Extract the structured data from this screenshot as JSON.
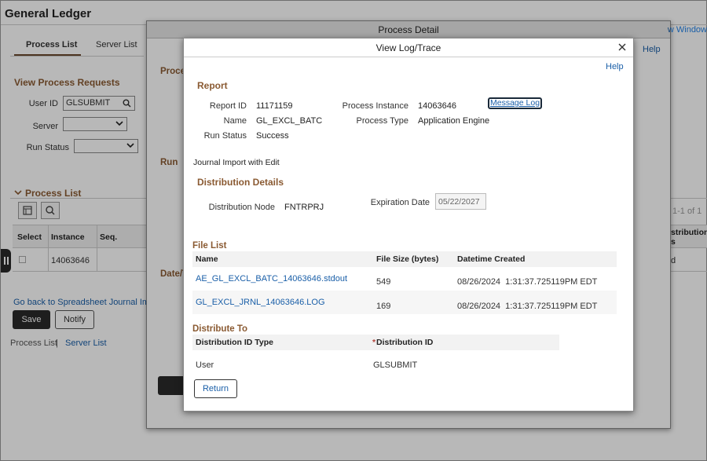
{
  "app": {
    "title": "General Ledger"
  },
  "tabs": [
    {
      "label": "Process List",
      "active": true
    },
    {
      "label": "Server List",
      "active": false
    }
  ],
  "view_requests": {
    "title": "View Process Requests",
    "user_id_label": "User ID",
    "user_id_value": "GLSUBMIT",
    "server_label": "Server",
    "server_value": "",
    "run_status_label": "Run Status",
    "run_status_value": ""
  },
  "process_list": {
    "title": "Process List",
    "pager": "1-1 of 1",
    "columns": [
      "Select",
      "Instance",
      "Seq."
    ],
    "right_col_header": "stribution\ns",
    "rows": [
      {
        "instance": "14063646",
        "right_cell": "d"
      }
    ]
  },
  "left_links": {
    "go_back": "Go back to Spreadsheet Journal Import",
    "save": "Save",
    "notify": "Notify",
    "process_list": "Process List",
    "separator": "|",
    "server_list": "Server List"
  },
  "process_detail": {
    "title": "Process Detail",
    "help": "Help",
    "new_window": "New Window",
    "proc_label": "Proce",
    "run_label": "Run",
    "date_label": "Date/T"
  },
  "log_modal": {
    "title": "View Log/Trace",
    "help": "Help",
    "report": {
      "title": "Report",
      "report_id_label": "Report ID",
      "report_id": "11171159",
      "process_instance_label": "Process Instance",
      "process_instance": "14063646",
      "message_log": "Message Log",
      "name_label": "Name",
      "name": "GL_EXCL_BATC",
      "process_type_label": "Process Type",
      "process_type": "Application Engine",
      "run_status_label": "Run Status",
      "run_status": "Success",
      "description": "Journal Import with Edit"
    },
    "distribution": {
      "title": "Distribution Details",
      "node_label": "Distribution Node",
      "node": "FNTRPRJ",
      "expiration_label": "Expiration Date",
      "expiration": "05/22/2027"
    },
    "file_list": {
      "title": "File List",
      "columns": [
        "Name",
        "File Size (bytes)",
        "Datetime Created"
      ],
      "rows": [
        {
          "name": "AE_GL_EXCL_BATC_14063646.stdout",
          "size": "549",
          "created": "08/26/2024  1:31:37.725119PM EDT"
        },
        {
          "name": "GL_EXCL_JRNL_14063646.LOG",
          "size": "169",
          "created": "08/26/2024  1:31:37.725119PM EDT"
        }
      ]
    },
    "distribute_to": {
      "title": "Distribute To",
      "columns": [
        "Distribution ID Type",
        "Distribution ID"
      ],
      "rows": [
        {
          "type": "User",
          "id": "GLSUBMIT"
        }
      ]
    },
    "return_button": "Return"
  },
  "colors": {
    "section_title": "#8a5a32",
    "link": "#1a5fa8",
    "dark_button": "#2a2a2a"
  }
}
